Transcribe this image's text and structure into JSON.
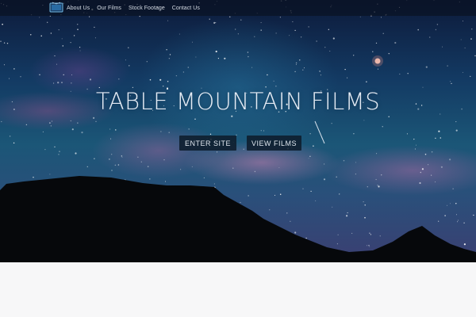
{
  "navbar": {
    "logo_icon": "film-monitor-logo",
    "links": [
      "About Us",
      "Our Films",
      "Stock Footage",
      "Contact Us"
    ]
  },
  "hero": {
    "title": "TABLE MOUNTAIN FILMS",
    "buttons": {
      "enter": "ENTER SITE",
      "films": "VIEW FILMS"
    }
  },
  "colors": {
    "nav_background": "#0a1222",
    "button_background": "#0e1c2c",
    "text": "#e6ecf5",
    "page_background": "#f7f7f8"
  }
}
